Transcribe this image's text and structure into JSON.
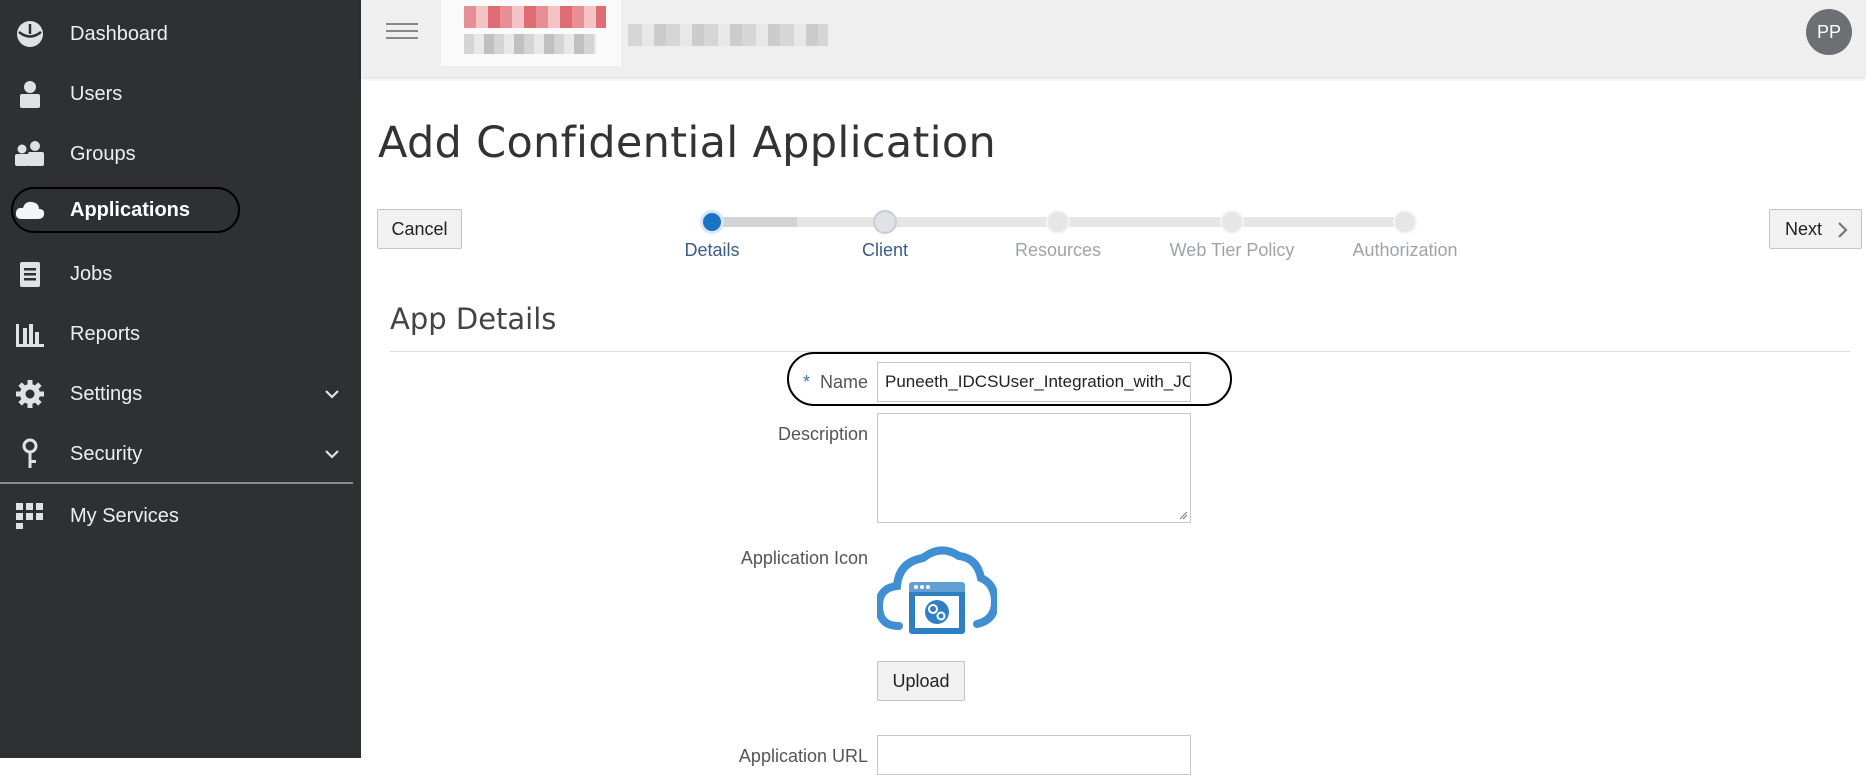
{
  "sidebar": {
    "items": [
      {
        "label": "Dashboard",
        "icon": "dashboard-icon"
      },
      {
        "label": "Users",
        "icon": "user-icon"
      },
      {
        "label": "Groups",
        "icon": "groups-icon"
      },
      {
        "label": "Applications",
        "icon": "cloud-icon",
        "active": true
      },
      {
        "label": "Jobs",
        "icon": "jobs-icon"
      },
      {
        "label": "Reports",
        "icon": "reports-icon"
      },
      {
        "label": "Settings",
        "icon": "gear-icon",
        "expandable": true
      },
      {
        "label": "Security",
        "icon": "key-icon",
        "expandable": true
      },
      {
        "label": "My Services",
        "icon": "grid-icon"
      }
    ]
  },
  "header": {
    "user_initials": "PP"
  },
  "page": {
    "title": "Add Confidential Application"
  },
  "toolbar": {
    "cancel_label": "Cancel",
    "next_label": "Next"
  },
  "wizard": {
    "steps": [
      {
        "label": "Details",
        "state": "current"
      },
      {
        "label": "Client",
        "state": "visited"
      },
      {
        "label": "Resources",
        "state": "pending"
      },
      {
        "label": "Web Tier Policy",
        "state": "pending"
      },
      {
        "label": "Authorization",
        "state": "pending"
      }
    ]
  },
  "form": {
    "section_title": "App Details",
    "required_marker": "*",
    "name_label": "Name",
    "name_value": "Puneeth_IDCSUser_Integration_with_JC",
    "description_label": "Description",
    "description_value": "",
    "icon_label": "Application Icon",
    "upload_label": "Upload",
    "url_label": "Application URL"
  },
  "colors": {
    "sidebar_bg": "#2e3034",
    "accent": "#1b73c4",
    "icon_blue": "#3f8fd2"
  }
}
